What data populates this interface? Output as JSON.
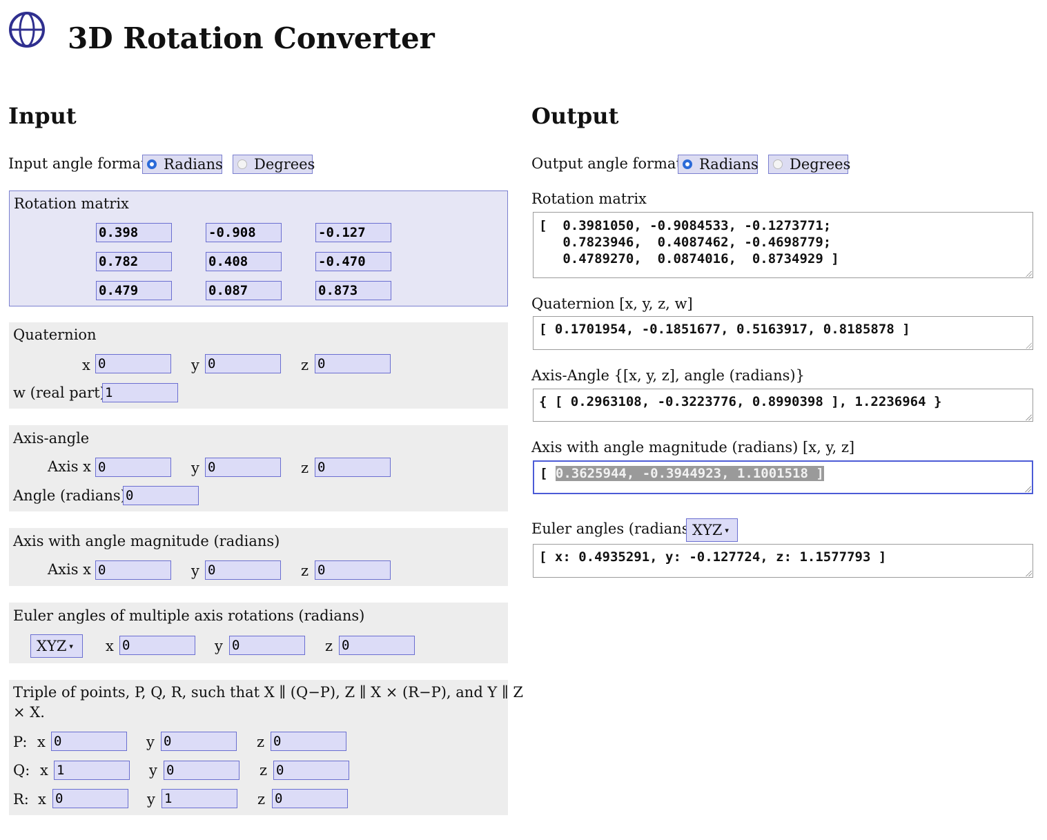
{
  "header": {
    "title": "3D Rotation Converter",
    "logo_icon": "globe-icon"
  },
  "input": {
    "heading": "Input",
    "format_label": "Input angle format",
    "format_options": [
      "Radians",
      "Degrees"
    ],
    "format_selected": "Radians",
    "rotation_matrix": {
      "label": "Rotation matrix",
      "values": [
        [
          "0.398",
          "-0.908",
          "-0.127"
        ],
        [
          "0.782",
          "0.408",
          "-0.470"
        ],
        [
          "0.479",
          "0.087",
          "0.873"
        ]
      ]
    },
    "quaternion": {
      "label": "Quaternion",
      "x_label": "x",
      "y_label": "y",
      "z_label": "z",
      "w_label": "w (real part)",
      "x": "0",
      "y": "0",
      "z": "0",
      "w": "1"
    },
    "axis_angle": {
      "label": "Axis-angle",
      "axis_x_label": "Axis x",
      "y_label": "y",
      "z_label": "z",
      "angle_label": "Angle (radians)",
      "x": "0",
      "y": "0",
      "z": "0",
      "angle": "0"
    },
    "axis_magnitude": {
      "label": "Axis with angle magnitude (radians)",
      "axis_x_label": "Axis x",
      "y_label": "y",
      "z_label": "z",
      "x": "0",
      "y": "0",
      "z": "0"
    },
    "euler": {
      "label": "Euler angles of multiple axis rotations (radians)",
      "order": "XYZ",
      "x_label": "x",
      "y_label": "y",
      "z_label": "z",
      "x": "0",
      "y": "0",
      "z": "0"
    },
    "points": {
      "label_line1": "Triple of points, P, Q, R, such that X ∥ (Q−P),   Z ∥ X × (R−P),  and Y ∥ Z",
      "label_line2": "× X.",
      "x_label": "x",
      "y_label": "y",
      "z_label": "z",
      "P": {
        "label": "P:",
        "x": "0",
        "y": "0",
        "z": "0"
      },
      "Q": {
        "label": "Q:",
        "x": "1",
        "y": "0",
        "z": "0"
      },
      "R": {
        "label": "R:",
        "x": "0",
        "y": "1",
        "z": "0"
      }
    }
  },
  "output": {
    "heading": "Output",
    "format_label": "Output angle format",
    "format_options": [
      "Radians",
      "Degrees"
    ],
    "format_selected": "Radians",
    "matrix_label": "Rotation matrix",
    "matrix_lines": [
      "[  0.3981050, -0.9084533, -0.1273771;",
      "   0.7823946,  0.4087462, -0.4698779;",
      "   0.4789270,  0.0874016,  0.8734929 ]"
    ],
    "quaternion_label": "Quaternion [x, y, z, w]",
    "quaternion_value": "[ 0.1701954, -0.1851677, 0.5163917, 0.8185878 ]",
    "axis_angle_label": "Axis-Angle {[x, y, z], angle (radians)}",
    "axis_angle_value": "{ [ 0.2963108, -0.3223776, 0.8990398 ], 1.2236964 }",
    "axis_magnitude_label": "Axis with angle magnitude (radians) [x, y, z]",
    "axis_magnitude_prefix": "[ ",
    "axis_magnitude_selected": "0.3625944, -0.3944923, 1.1001518 ]",
    "euler_label": "Euler angles (radians)",
    "euler_order": "XYZ",
    "euler_value": "[ x: 0.4935291, y: -0.127724, z: 1.1577793 ]"
  }
}
